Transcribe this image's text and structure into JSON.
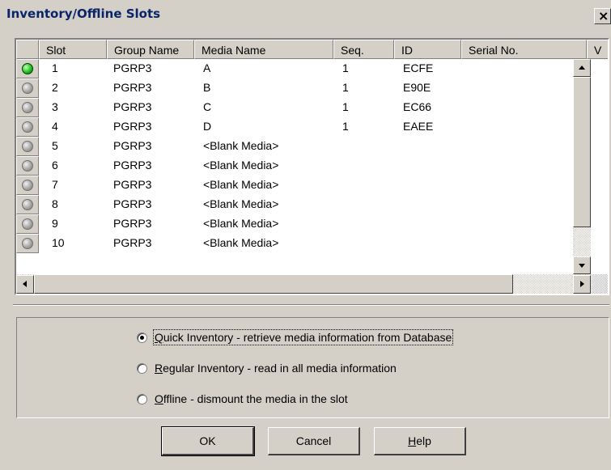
{
  "window": {
    "title": "Inventory/Offline Slots",
    "close_glyph": "×"
  },
  "grid": {
    "headers": [
      "Slot",
      "Group Name",
      "Media Name",
      "Seq.",
      "ID",
      "Serial No.",
      "V"
    ],
    "rows": [
      {
        "slot": "1",
        "group": "PGRP3",
        "media": "A",
        "seq": "1",
        "id": "ECFE",
        "serial": "",
        "active": true
      },
      {
        "slot": "2",
        "group": "PGRP3",
        "media": "B",
        "seq": "1",
        "id": "E90E",
        "serial": "",
        "active": false
      },
      {
        "slot": "3",
        "group": "PGRP3",
        "media": "C",
        "seq": "1",
        "id": "EC66",
        "serial": "",
        "active": false
      },
      {
        "slot": "4",
        "group": "PGRP3",
        "media": "D",
        "seq": "1",
        "id": "EAEE",
        "serial": "",
        "active": false
      },
      {
        "slot": "5",
        "group": "PGRP3",
        "media": "<Blank Media>",
        "seq": "",
        "id": "",
        "serial": "",
        "active": false
      },
      {
        "slot": "6",
        "group": "PGRP3",
        "media": "<Blank Media>",
        "seq": "",
        "id": "",
        "serial": "",
        "active": false
      },
      {
        "slot": "7",
        "group": "PGRP3",
        "media": "<Blank Media>",
        "seq": "",
        "id": "",
        "serial": "",
        "active": false
      },
      {
        "slot": "8",
        "group": "PGRP3",
        "media": "<Blank Media>",
        "seq": "",
        "id": "",
        "serial": "",
        "active": false
      },
      {
        "slot": "9",
        "group": "PGRP3",
        "media": "<Blank Media>",
        "seq": "",
        "id": "",
        "serial": "",
        "active": false
      },
      {
        "slot": "10",
        "group": "PGRP3",
        "media": "<Blank Media>",
        "seq": "",
        "id": "",
        "serial": "",
        "active": false
      }
    ]
  },
  "options": {
    "quick": {
      "accel": "Q",
      "rest": "uick Inventory - retrieve media information from Database",
      "selected": true
    },
    "regular": {
      "accel": "R",
      "rest": "egular Inventory - read in all media information",
      "selected": false
    },
    "offline": {
      "accel": "O",
      "rest": "ffline - dismount the media in the slot",
      "selected": false
    }
  },
  "buttons": {
    "ok": "OK",
    "cancel": "Cancel",
    "help_accel": "H",
    "help_rest": "elp"
  },
  "colors": {
    "active_led": "#20c020",
    "title_text": "#0a246a",
    "face": "#d4d0c8"
  }
}
